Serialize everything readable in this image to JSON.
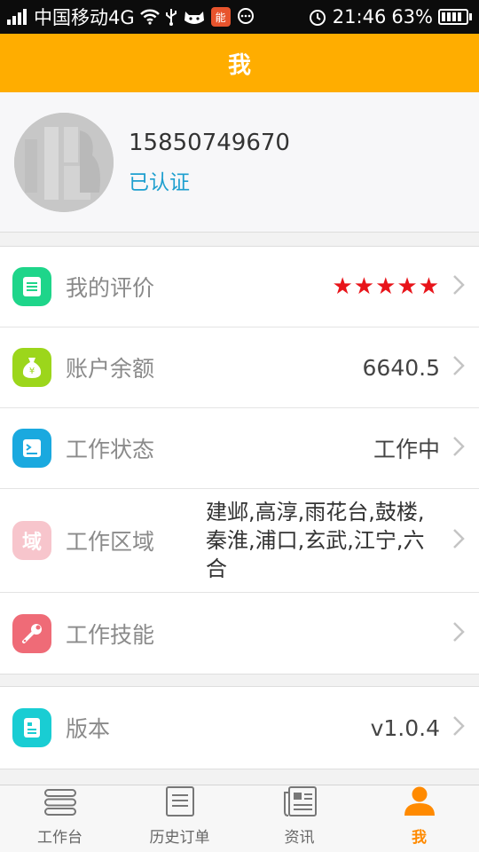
{
  "status_bar": {
    "carrier": "中国移动4G",
    "time": "21:46",
    "battery": "63%"
  },
  "header": {
    "title": "我"
  },
  "profile": {
    "phone": "15850749670",
    "verified_label": "已认证"
  },
  "menu": {
    "rating": {
      "label": "我的评价",
      "stars": "★★★★★",
      "star_count": 5,
      "icon": "list-icon",
      "icon_color": "#1ed58a"
    },
    "balance": {
      "label": "账户余额",
      "value": "6640.5",
      "icon": "money-bag-icon",
      "icon_color": "#9cd61b"
    },
    "work_status": {
      "label": "工作状态",
      "value": "工作中",
      "icon": "status-icon",
      "icon_color": "#1aa9df"
    },
    "work_area": {
      "label": "工作区域",
      "value": "建邺,高淳,雨花台,鼓楼,秦淮,浦口,玄武,江宁,六合",
      "icon_text": "域",
      "icon_color": "#f7c5cc"
    },
    "work_skill": {
      "label": "工作技能",
      "icon": "wrench-icon",
      "icon_color": "#ef6b77"
    },
    "version": {
      "label": "版本",
      "value": "v1.0.4",
      "icon": "document-icon",
      "icon_color": "#19cdd3"
    }
  },
  "tabbar": {
    "items": [
      {
        "label": "工作台",
        "icon": "workbench-icon"
      },
      {
        "label": "历史订单",
        "icon": "history-order-icon"
      },
      {
        "label": "资讯",
        "icon": "news-icon"
      },
      {
        "label": "我",
        "icon": "profile-icon"
      }
    ],
    "active_index": 3,
    "active_color": "#ff8a00"
  },
  "colors": {
    "accent": "#ffad00",
    "link": "#1e9fcf"
  }
}
